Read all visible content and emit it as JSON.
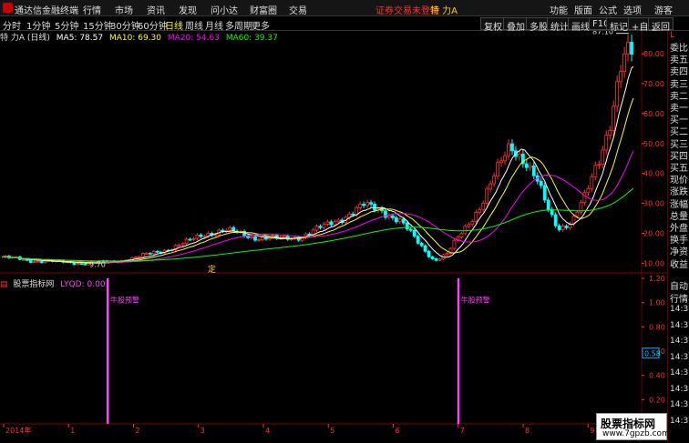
{
  "app": {
    "title": "通达信金融终端"
  },
  "menu": [
    "行情",
    "市场",
    "资讯",
    "发现",
    "问小达",
    "财富圈",
    "交易"
  ],
  "trade_alert": "证券交易未登录",
  "current_stock": "特 力A",
  "right_menu": [
    "功能",
    "版面",
    "公式",
    "选项"
  ],
  "guest": "游客",
  "periods": [
    "分时",
    "1分钟",
    "5分钟",
    "15分钟",
    "30分钟",
    "60分钟",
    "日线",
    "周线",
    "月线",
    "多周期",
    "更多"
  ],
  "active_period": "日线",
  "tool_buttons": [
    "复权",
    "叠加",
    "多股",
    "统计",
    "画线",
    "F10",
    "标记",
    "+自选",
    "返回"
  ],
  "main_info": {
    "title": "特 力A (日线)",
    "ma5": "MA5: 78.57",
    "ma10": "MA10: 69.30",
    "ma20": "MA20: 54.63",
    "ma60": "MA60: 39.37"
  },
  "sub_info": {
    "title": "股票指标网",
    "value": "LYQD: 0.00"
  },
  "colors": {
    "up": "#ff3030",
    "down": "#00ffff",
    "ma5": "#ffffff",
    "ma10": "#ffff00",
    "ma20": "#ff00ff",
    "ma60": "#00ff00",
    "signal": "#ff40ff",
    "axis": "#ff3030"
  },
  "chart_data": [
    {
      "type": "candlestick",
      "title": "",
      "ylim": [
        8,
        87
      ],
      "yticks": [
        "10.00",
        "20.00",
        "30.00",
        "40.00",
        "50.00",
        "60.00",
        "70.00",
        "80.00"
      ],
      "annotations": {
        "high_label": "87.10",
        "low_label": "9.70",
        "marker": "定"
      },
      "ma_lines": [
        "MA5",
        "MA10",
        "MA20",
        "MA60"
      ],
      "x_months": [
        "2014年",
        "1",
        "2",
        "3",
        "4",
        "5",
        "6",
        "7",
        "8",
        "9"
      ]
    },
    {
      "type": "bar",
      "title": "股票指标网",
      "ylim": [
        0,
        1.2
      ],
      "yticks": [
        "0.20",
        "0.40",
        "0.60",
        "0.80",
        "1.00",
        "1.20"
      ],
      "current_value_label": "0.58",
      "signals": [
        {
          "month_index": 1.6,
          "label": "牛股预警"
        },
        {
          "month_index": 7.0,
          "label": "牛股预警"
        }
      ]
    }
  ],
  "right_panel": {
    "items": [
      "委比",
      "卖五",
      "卖四",
      "卖三",
      "卖二",
      "卖一",
      "买一",
      "买二",
      "买三",
      "买四",
      "买五",
      "现价",
      "涨跌",
      "涨幅",
      "总量",
      "外盘",
      "换手",
      "净资",
      "收益"
    ],
    "header": "L",
    "auto_label": "自动",
    "quote_label": "行情",
    "times": [
      "14:35",
      "14:35",
      "14:35",
      "14:35",
      "14:35",
      "14:35",
      "14:35",
      "14:35"
    ]
  },
  "watermark": {
    "line1": "股票指标网",
    "line2": "www.7gpzb.com"
  }
}
